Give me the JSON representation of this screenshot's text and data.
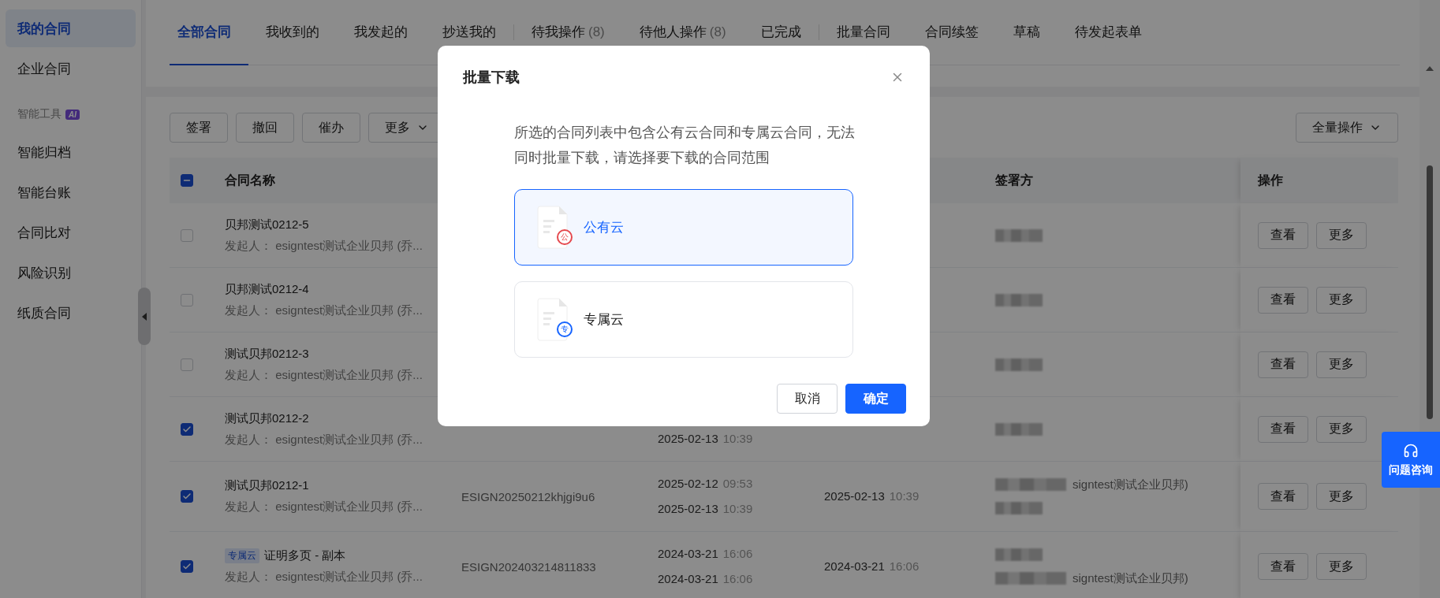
{
  "sidebar": {
    "items": [
      {
        "kind": "item",
        "label": "我的合同",
        "selected": true
      },
      {
        "kind": "item",
        "label": "企业合同",
        "selected": false
      },
      {
        "kind": "section",
        "label": "智能工具",
        "badge": "AI"
      },
      {
        "kind": "item",
        "label": "智能归档",
        "selected": false
      },
      {
        "kind": "item",
        "label": "智能台账",
        "selected": false
      },
      {
        "kind": "item",
        "label": "合同比对",
        "selected": false
      },
      {
        "kind": "item",
        "label": "风险识别",
        "selected": false
      },
      {
        "kind": "item",
        "label": "纸质合同",
        "selected": false
      }
    ]
  },
  "tabs": [
    {
      "label": "全部合同",
      "selected": true
    },
    {
      "label": "我收到的",
      "selected": false
    },
    {
      "label": "我发起的",
      "selected": false
    },
    {
      "label": "抄送我的",
      "selected": false,
      "divider_after": true
    },
    {
      "label": "待我操作",
      "count": "(8)",
      "selected": false
    },
    {
      "label": "待他人操作",
      "count": "(8)",
      "selected": false
    },
    {
      "label": "已完成",
      "selected": false,
      "divider_after": true
    },
    {
      "label": "批量合同",
      "selected": false
    },
    {
      "label": "合同续签",
      "selected": false
    },
    {
      "label": "草稿",
      "selected": false
    },
    {
      "label": "待发起表单",
      "selected": false
    }
  ],
  "toolbar": {
    "buttons": [
      {
        "label": "签署",
        "dropdown": false
      },
      {
        "label": "撤回",
        "dropdown": false
      },
      {
        "label": "催办",
        "dropdown": false
      },
      {
        "label": "更多",
        "dropdown": true
      }
    ],
    "bulk_button": {
      "label": "全量操作",
      "dropdown": true
    }
  },
  "table": {
    "header_indeterminate": true,
    "columns": {
      "name": "合同名称",
      "signer": "签署方",
      "actions": "操作"
    },
    "rows": [
      {
        "checked": false,
        "name": "贝邦测试0212-5",
        "initiator_label": "发起人：",
        "initiator": "esigntest测试企业贝邦 (乔...",
        "created": [],
        "signer_lines": [
          {
            "kind": "blurred"
          }
        ],
        "actions": [
          "查看",
          "更多"
        ]
      },
      {
        "checked": false,
        "name": "贝邦测试0212-4",
        "initiator_label": "发起人：",
        "initiator": "esigntest测试企业贝邦 (乔...",
        "created": [],
        "signer_lines": [
          {
            "kind": "blurred"
          }
        ],
        "actions": [
          "查看",
          "更多"
        ]
      },
      {
        "checked": false,
        "name": "测试贝邦0212-3",
        "initiator_label": "发起人：",
        "initiator": "esigntest测试企业贝邦 (乔...",
        "created": [],
        "signer_lines": [
          {
            "kind": "blurred"
          }
        ],
        "actions": [
          "查看",
          "更多"
        ]
      },
      {
        "checked": true,
        "name": "测试贝邦0212-2",
        "initiator_label": "发起人：",
        "initiator": "esigntest测试企业贝邦 (乔...",
        "created": [
          {
            "date": "2025-02-13",
            "time": "10:39"
          }
        ],
        "signer_lines": [
          {
            "kind": "blurred"
          }
        ],
        "actions": [
          "查看",
          "更多"
        ]
      },
      {
        "checked": true,
        "name": "测试贝邦0212-1",
        "initiator_label": "发起人：",
        "initiator": "esigntest测试企业贝邦 (乔...",
        "number": "ESIGN20250212khjgi9u6",
        "created": [
          {
            "date": "2025-02-12",
            "time": "09:53"
          },
          {
            "date": "2025-02-13",
            "time": "10:39"
          }
        ],
        "signed": {
          "date": "2025-02-13",
          "time": "10:39"
        },
        "signer_lines": [
          {
            "kind": "partial",
            "text": "signtest测试企业贝邦)"
          },
          {
            "kind": "blurred"
          }
        ],
        "actions": [
          "查看",
          "更多"
        ]
      },
      {
        "checked": true,
        "tag": "专属云",
        "name": "证明多页 - 副本",
        "initiator_label": "发起人：",
        "initiator": "esigntest测试企业贝邦 (乔...",
        "number": "ESIGN202403214811833",
        "created": [
          {
            "date": "2024-03-21",
            "time": "16:06"
          },
          {
            "date": "2024-03-21",
            "time": "16:06"
          }
        ],
        "signed": {
          "date": "2024-03-21",
          "time": "16:06"
        },
        "signer_lines": [
          {
            "kind": "blurred"
          },
          {
            "kind": "partial",
            "text": "signtest测试企业贝邦)"
          }
        ],
        "actions": [
          "查看",
          "更多"
        ]
      }
    ]
  },
  "dialog": {
    "title": "批量下载",
    "message": "所选的合同列表中包含公有云合同和专属云合同，无法同时批量下载，请选择要下载的合同范围",
    "options": [
      {
        "label": "公有云",
        "stamp": "公",
        "color": "#e5484d",
        "selected": true
      },
      {
        "label": "专属云",
        "stamp": "专",
        "color": "#1664ff",
        "selected": false
      }
    ],
    "buttons": [
      {
        "label": "取消",
        "kind": "secondary"
      },
      {
        "label": "确定",
        "kind": "primary"
      }
    ]
  },
  "help_button": {
    "label": "问题咨询"
  }
}
